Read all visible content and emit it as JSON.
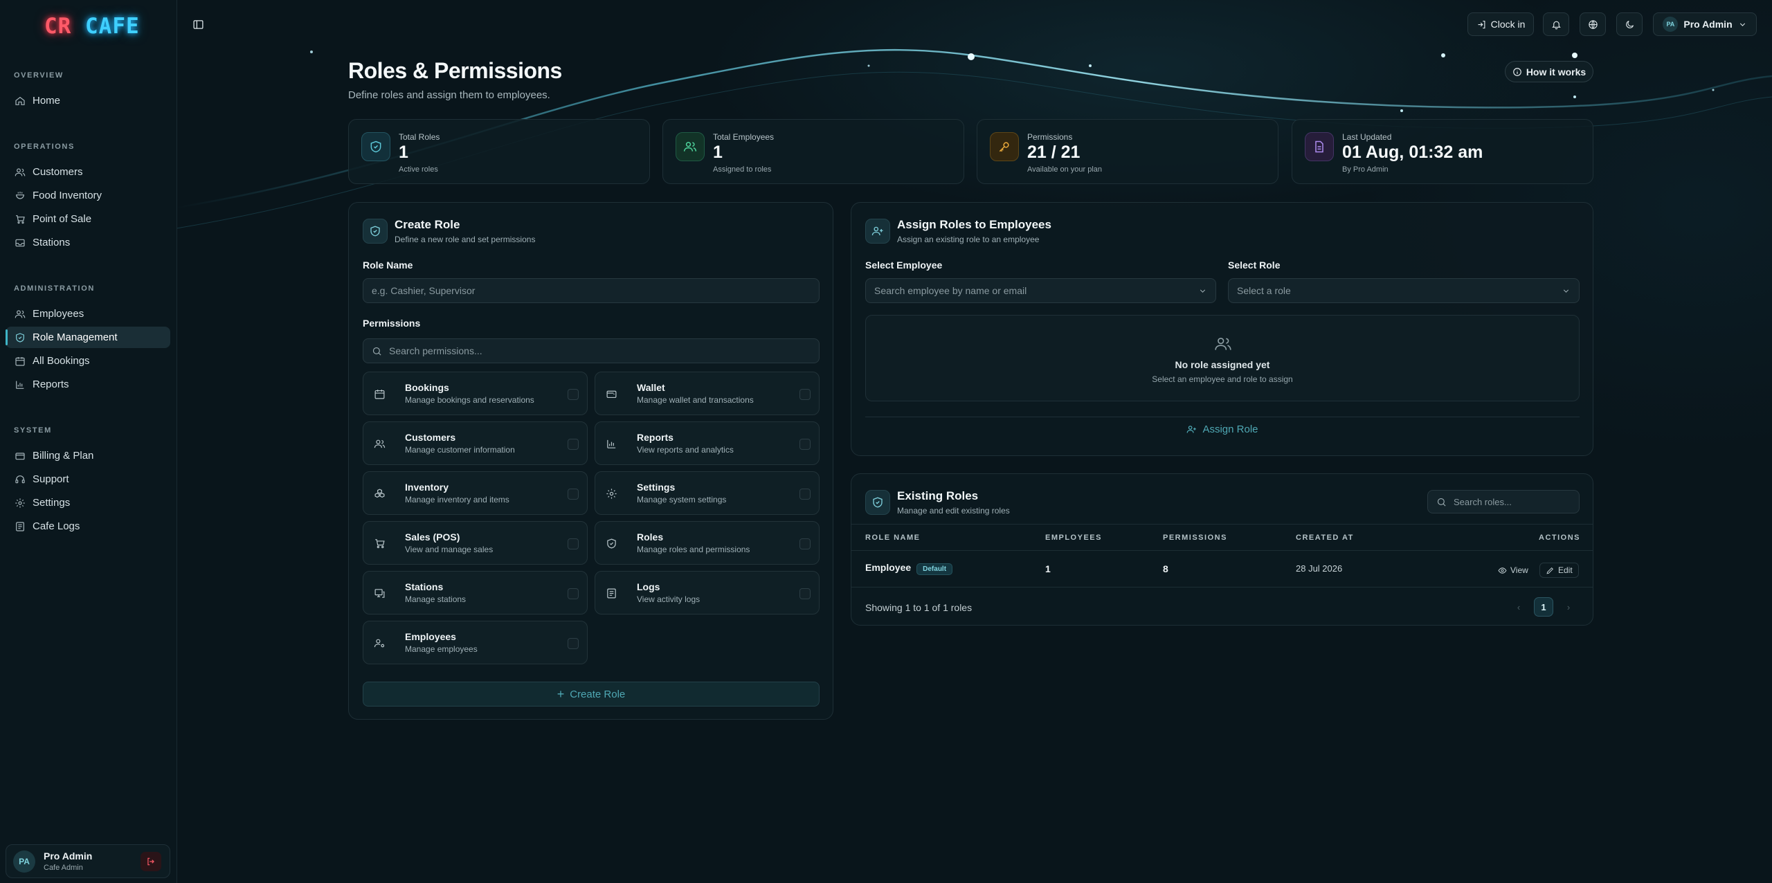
{
  "app": {
    "logo_part1": "CR",
    "logo_part2": "CAFE"
  },
  "sidebar": {
    "sections": [
      "OVERVIEW",
      "OPERATIONS",
      "ADMINISTRATION",
      "SYSTEM"
    ],
    "items": [
      {
        "label": "Home",
        "icon": "home-icon"
      },
      {
        "label": "Customers",
        "icon": "users-icon"
      },
      {
        "label": "Food Inventory",
        "icon": "food-icon"
      },
      {
        "label": "Point of Sale",
        "icon": "cart-icon"
      },
      {
        "label": "Stations",
        "icon": "inbox-icon"
      },
      {
        "label": "Employees",
        "icon": "users-icon"
      },
      {
        "label": "Role Management",
        "icon": "shield-icon",
        "active": true
      },
      {
        "label": "All Bookings",
        "icon": "calendar-icon"
      },
      {
        "label": "Reports",
        "icon": "bar-chart-icon"
      },
      {
        "label": "Billing & Plan",
        "icon": "wallet-icon"
      },
      {
        "label": "Support",
        "icon": "headset-icon"
      },
      {
        "label": "Settings",
        "icon": "gear-icon"
      },
      {
        "label": "Cafe Logs",
        "icon": "logs-icon"
      }
    ],
    "user": {
      "initials": "PA",
      "name": "Pro Admin",
      "role": "Cafe Admin"
    }
  },
  "topbar": {
    "clock_in": "Clock in",
    "user_initials": "PA",
    "user_name": "Pro Admin"
  },
  "page": {
    "title": "Roles & Permissions",
    "subtitle": "Define roles and assign them to employees.",
    "how_it_works": "How it works"
  },
  "stats": [
    {
      "label": "Total Roles",
      "value": "1",
      "sub": "Active roles",
      "color": "#3fb6c8"
    },
    {
      "label": "Total Employees",
      "value": "1",
      "sub": "Assigned to roles",
      "color": "#3fc48e"
    },
    {
      "label": "Permissions",
      "value": "21 / 21",
      "sub": "Available on your plan",
      "color": "#e0a030"
    },
    {
      "label": "Last Updated",
      "value": "01 Aug, 01:32 am",
      "sub": "By Pro Admin",
      "color": "#a27ce8"
    }
  ],
  "create_role": {
    "title": "Create Role",
    "subtitle": "Define a new role and set permissions",
    "role_name_label": "Role Name",
    "role_name_placeholder": "e.g. Cashier, Supervisor",
    "permissions_label": "Permissions",
    "search_placeholder": "Search permissions...",
    "permissions": [
      {
        "name": "Bookings",
        "desc": "Manage bookings and reservations",
        "icon": "calendar-icon"
      },
      {
        "name": "Wallet",
        "desc": "Manage wallet and transactions",
        "icon": "wallet-icon"
      },
      {
        "name": "Customers",
        "desc": "Manage customer information",
        "icon": "users-icon"
      },
      {
        "name": "Reports",
        "desc": "View reports and analytics",
        "icon": "bar-chart-icon"
      },
      {
        "name": "Inventory",
        "desc": "Manage inventory and items",
        "icon": "boxes-icon"
      },
      {
        "name": "Settings",
        "desc": "Manage system settings",
        "icon": "gear-icon"
      },
      {
        "name": "Sales (POS)",
        "desc": "View and manage sales",
        "icon": "cart-icon"
      },
      {
        "name": "Roles",
        "desc": "Manage roles and permissions",
        "icon": "shield-icon"
      },
      {
        "name": "Stations",
        "desc": "Manage stations",
        "icon": "monitor-icon"
      },
      {
        "name": "Logs",
        "desc": "View activity logs",
        "icon": "logs-icon"
      },
      {
        "name": "Employees",
        "desc": "Manage employees",
        "icon": "user-gear-icon"
      }
    ],
    "button": "Create Role"
  },
  "assign": {
    "title": "Assign Roles to Employees",
    "subtitle": "Assign an existing role to an employee",
    "employee_label": "Select Employee",
    "employee_placeholder": "Search employee by name or email",
    "role_label": "Select Role",
    "role_placeholder": "Select a role",
    "empty_title": "No role assigned yet",
    "empty_sub": "Select an employee and role to assign",
    "button": "Assign Role"
  },
  "existing": {
    "title": "Existing Roles",
    "subtitle": "Manage and edit existing roles",
    "search_placeholder": "Search roles...",
    "columns": [
      "ROLE NAME",
      "EMPLOYEES",
      "PERMISSIONS",
      "CREATED AT",
      "ACTIONS"
    ],
    "rows": [
      {
        "name": "Employee",
        "badge": "Default",
        "employees": "1",
        "permissions": "8",
        "created": "28 Jul 2026",
        "view": "View",
        "edit": "Edit"
      }
    ],
    "footer": "Showing 1 to 1 of 1 roles",
    "page": "1"
  }
}
